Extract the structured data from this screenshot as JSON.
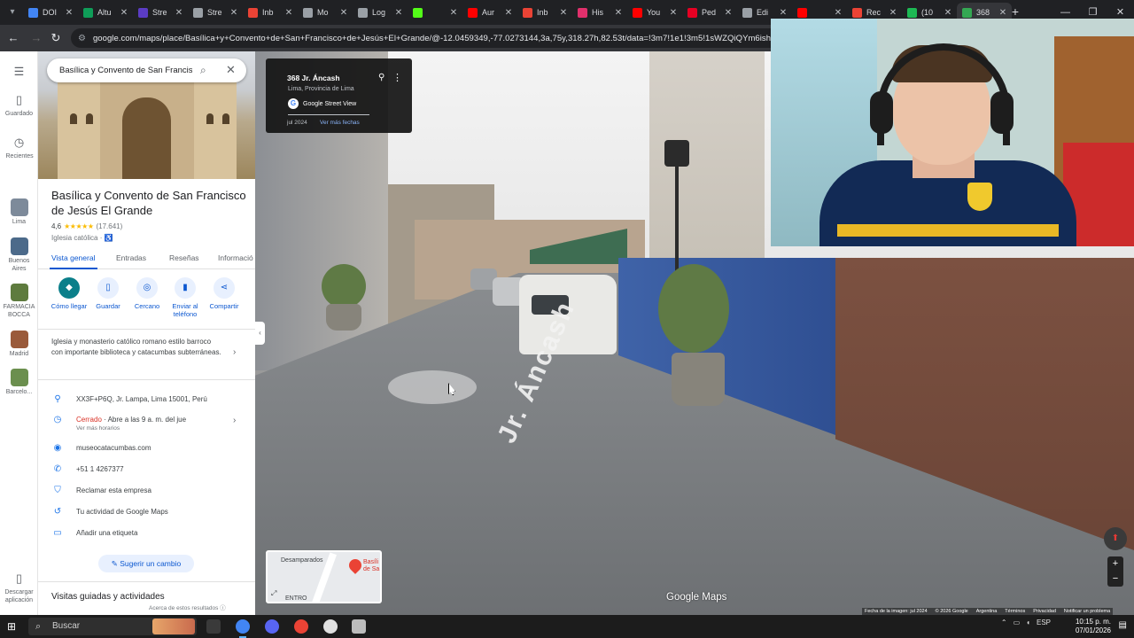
{
  "browser": {
    "tabs": [
      {
        "title": "DOI",
        "color": "#4285f4"
      },
      {
        "title": "Altu",
        "color": "#0f9d58"
      },
      {
        "title": "Stre",
        "color": "#5b3cc4"
      },
      {
        "title": "Stre",
        "color": "#9aa0a6"
      },
      {
        "title": "Inb",
        "color": "#ea4335"
      },
      {
        "title": "Mo",
        "color": "#9aa0a6"
      },
      {
        "title": "Log",
        "color": "#9aa0a6"
      },
      {
        "title": "",
        "color": "#53fc18"
      },
      {
        "title": "Aur",
        "color": "#ff0000"
      },
      {
        "title": "Inb",
        "color": "#ea4335"
      },
      {
        "title": "His",
        "color": "#e1306c"
      },
      {
        "title": "You",
        "color": "#ff0000"
      },
      {
        "title": "Ped",
        "color": "#e60023"
      },
      {
        "title": "Edi",
        "color": "#9aa0a6"
      },
      {
        "title": "",
        "color": "#ff0000"
      },
      {
        "title": "Rec",
        "color": "#ea4335"
      },
      {
        "title": "(10",
        "color": "#1db954"
      },
      {
        "title": "368",
        "color": "#34a853"
      }
    ],
    "url": "google.com/maps/place/Basílica+y+Convento+de+San+Francisco+de+Jesús+El+Grande/@-12.0459349,-77.0273144,3a,75y,318.27h,82.53t/data=!3m7!1e1!3m5!1sWZQiQYm6ishCjEb"
  },
  "rail": {
    "saved": "Guardado",
    "recent": "Recientes",
    "recents": [
      {
        "label": "Lima",
        "color": "#7d8a9a"
      },
      {
        "label": "Buenos Aires",
        "color": "#4c6a8a"
      },
      {
        "label": "FARMACIA BOCCA",
        "color": "#5e7b3e"
      },
      {
        "label": "Madrid",
        "color": "#9a5a3a"
      },
      {
        "label": "Barcelo...",
        "color": "#6b8f4e"
      }
    ],
    "download": "Descargar aplicación"
  },
  "place": {
    "search_value": "Basílica y Convento de San Francisc",
    "title": "Basílica y Convento de San Francisco de Jesús El Grande",
    "rating": "4,6",
    "stars": "★★★★★",
    "reviews": "(17.641)",
    "category": "Iglesia católica · ♿",
    "tabs": [
      "Vista general",
      "Entradas",
      "Reseñas",
      "Informació"
    ],
    "actions": [
      {
        "label": "Cómo llegar",
        "icon": "◆"
      },
      {
        "label": "Guardar",
        "icon": "▯"
      },
      {
        "label": "Cercano",
        "icon": "◎"
      },
      {
        "label": "Enviar al teléfono",
        "icon": "▮"
      },
      {
        "label": "Compartir",
        "icon": "⋖"
      }
    ],
    "description": "Iglesia y monasterio católico romano estilo barroco con importante biblioteca y catacumbas subterráneas.",
    "address": "XX3F+P6Q, Jr. Lampa, Lima 15001, Perú",
    "hours_status": "Cerrado",
    "hours_rest": " · Abre a las 9 a. m. del jue",
    "hours_link": "Ver más horarios",
    "website": "museocatacumbas.com",
    "phone": "+51 1 4267377",
    "claim": "Reclamar esta empresa",
    "activity": "Tu actividad de Google Maps",
    "label": "Añadir una etiqueta",
    "suggest": "Sugerir un cambio",
    "guided_heading": "Visitas guiadas y actividades",
    "results_note": "Acerca de estos resultados"
  },
  "streetview": {
    "address": "368 Jr. Áncash",
    "region": "Lima, Provincia de Lima",
    "source": "Google Street View",
    "date": "jul 2024",
    "more_dates": "Ver más fechas",
    "street_marking": "Jr. Áncash",
    "minimap_a": "Desamparados",
    "minimap_b": "ENTRO",
    "minimap_c": "Basíli de Sa",
    "logo": "Google Maps",
    "legal": [
      "Fecha de la imagen: jul 2024",
      "© 2026 Google",
      "Argentina",
      "Términos",
      "Privacidad",
      "Notificar un problema"
    ]
  },
  "taskbar": {
    "search": "Buscar",
    "lang": "ESP",
    "time": "10:15 p. m.",
    "date": "07/01/2026"
  }
}
